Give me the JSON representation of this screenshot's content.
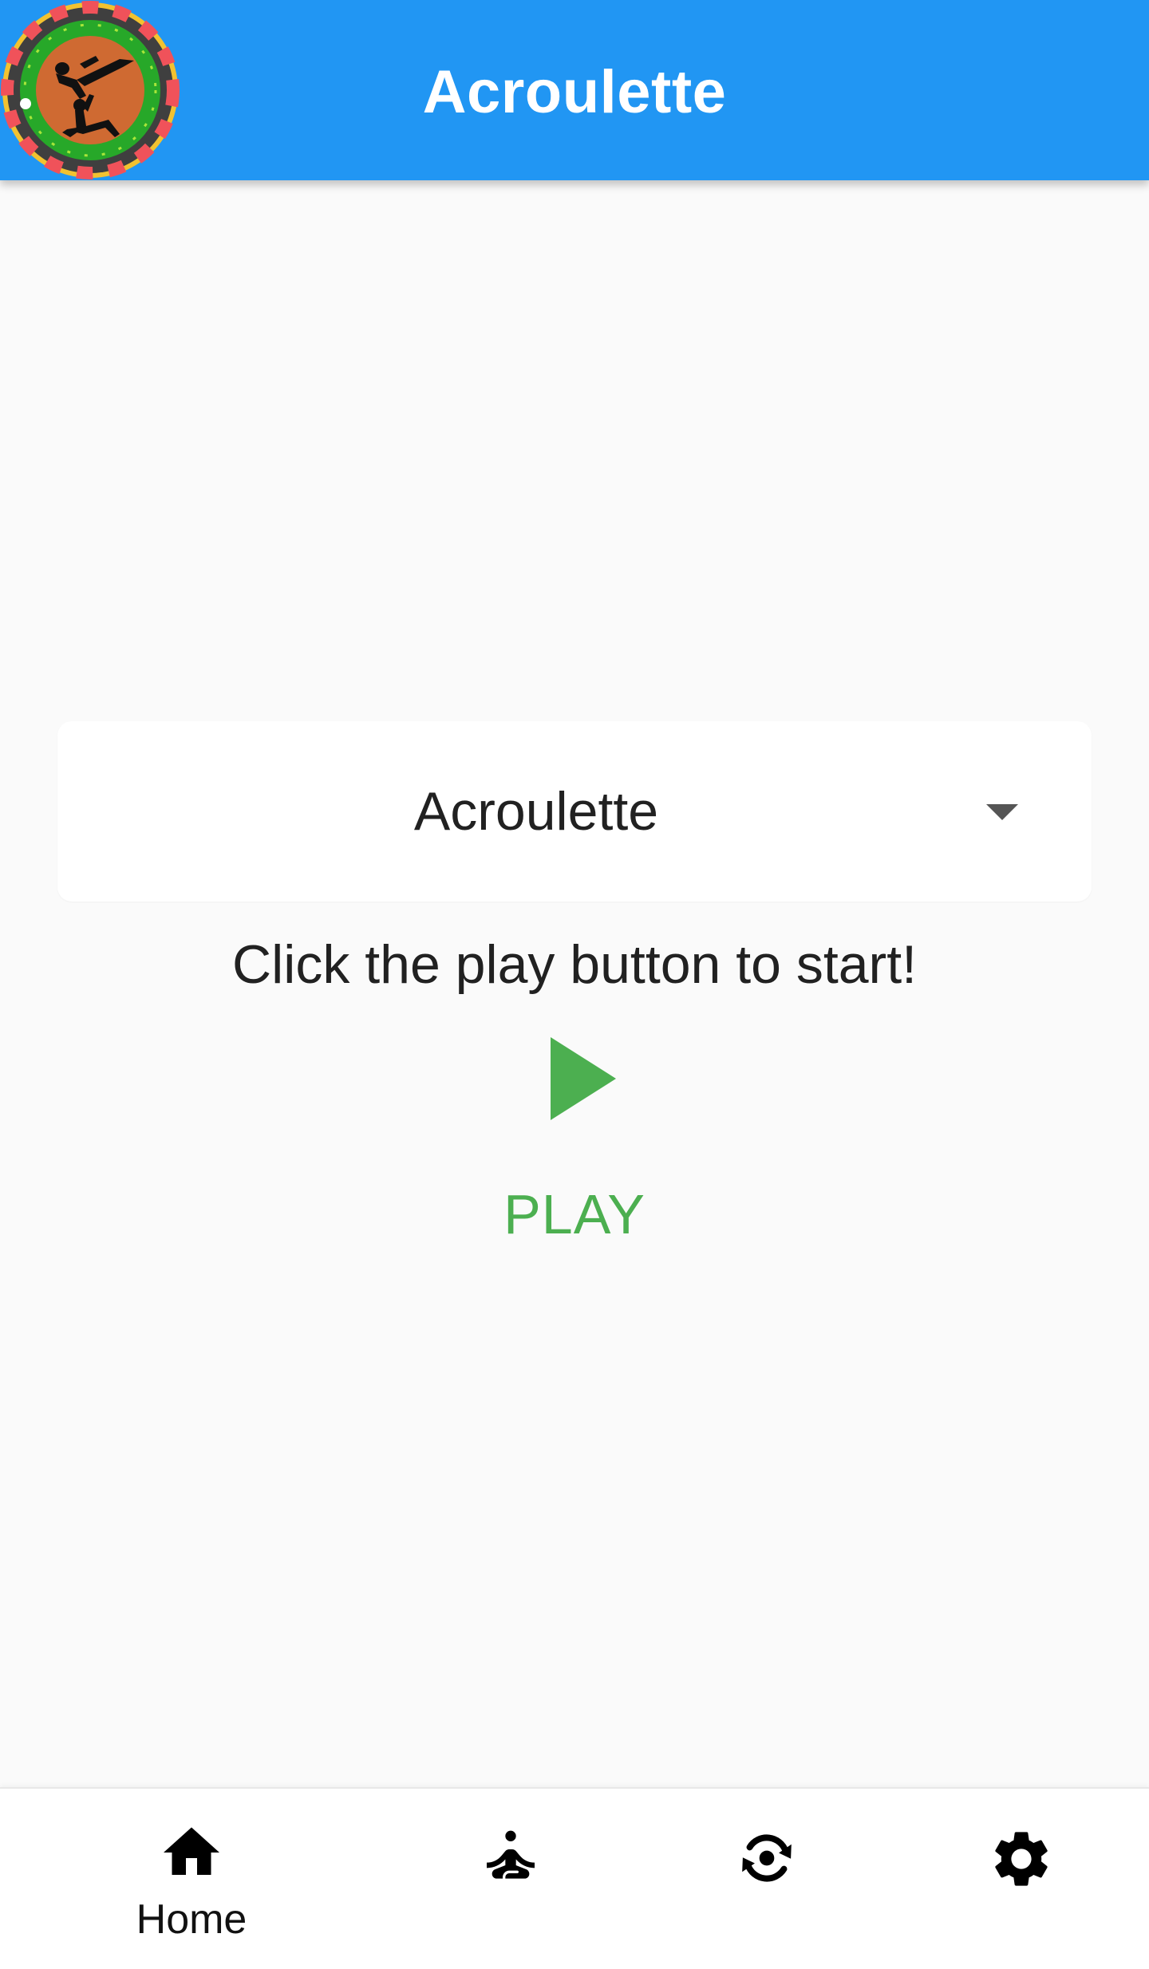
{
  "app_bar": {
    "title": "Acroulette",
    "logo_icon": "acroulette-roulette-logo-icon",
    "background_color": "#2196f3"
  },
  "main": {
    "dropdown": {
      "selected": "Acroulette"
    },
    "instruction": "Click the play button to start!",
    "play_button": {
      "icon": "play-icon",
      "label": "PLAY",
      "color": "#4caf50"
    }
  },
  "bottom_nav": {
    "items": [
      {
        "label": "Home",
        "icon": "home-icon",
        "active": true
      },
      {
        "label": "",
        "icon": "yoga-pose-icon",
        "active": false
      },
      {
        "label": "",
        "icon": "camera-switch-icon",
        "active": false
      },
      {
        "label": "",
        "icon": "gear-icon",
        "active": false
      }
    ]
  }
}
